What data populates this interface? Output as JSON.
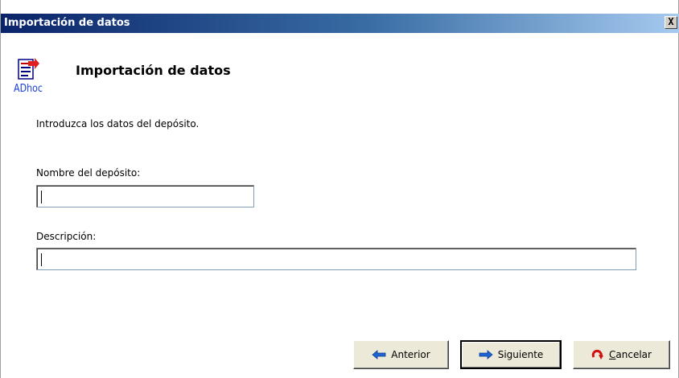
{
  "window": {
    "title": "Importación de datos",
    "close_label": "X"
  },
  "header": {
    "title": "Importación de datos",
    "icon_text": "ADhoc"
  },
  "instruction": "Introduzca los datos del depósito.",
  "form": {
    "name_label": "Nombre del depósito:",
    "name_value": "",
    "description_label": "Descripción:",
    "description_value": ""
  },
  "buttons": {
    "previous": "Anterior",
    "next": "Siguiente",
    "cancel_first_letter": "C",
    "cancel_rest": "ancelar"
  },
  "icons": {
    "previous": "arrow-left-icon",
    "next": "arrow-right-icon",
    "cancel": "cancel-red-arrow-icon"
  }
}
